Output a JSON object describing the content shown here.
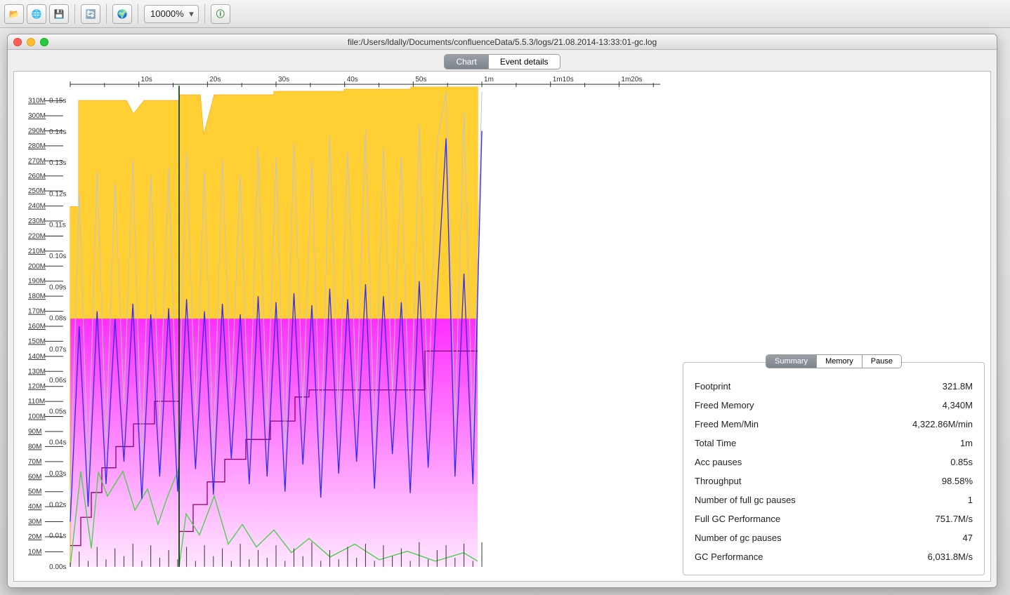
{
  "toolbar": {
    "zoom_value": "10000%",
    "icons": [
      "folder",
      "globe",
      "save",
      "refresh",
      "world",
      "info"
    ]
  },
  "window": {
    "title": "file:/Users/ldally/Documents/confluenceData/5.5.3/logs/21.08.2014-13:33:01-gc.log",
    "tabs": {
      "chart": "Chart",
      "details": "Event details"
    }
  },
  "summary": {
    "tabs": {
      "summary": "Summary",
      "memory": "Memory",
      "pause": "Pause"
    },
    "rows": [
      {
        "label": "Footprint",
        "value": "321.8M"
      },
      {
        "label": "Freed Memory",
        "value": "4,340M"
      },
      {
        "label": "Freed Mem/Min",
        "value": "4,322.86M/min"
      },
      {
        "label": "Total Time",
        "value": "1m"
      },
      {
        "label": "Acc pauses",
        "value": "0.85s"
      },
      {
        "label": "Throughput",
        "value": "98.58%"
      },
      {
        "label": "Number of full gc pauses",
        "value": "1"
      },
      {
        "label": "Full GC Performance",
        "value": "751.7M/s"
      },
      {
        "label": "Number of gc pauses",
        "value": "47"
      },
      {
        "label": "GC Performance",
        "value": "6,031.8M/s"
      }
    ]
  },
  "chart_data": {
    "type": "area",
    "xlabel": "time",
    "x_ticks": [
      "",
      "10s",
      "20s",
      "30s",
      "40s",
      "50s",
      "1m",
      "1m10s",
      "1m20s"
    ],
    "y_left_memory_ticks_M": [
      10,
      20,
      30,
      40,
      50,
      60,
      70,
      80,
      90,
      100,
      110,
      120,
      130,
      140,
      150,
      160,
      170,
      180,
      190,
      200,
      210,
      220,
      230,
      240,
      250,
      260,
      270,
      280,
      290,
      300,
      310
    ],
    "y_right_pause_ticks_s": [
      0.0,
      0.01,
      0.02,
      0.03,
      0.04,
      0.05,
      0.06,
      0.07,
      0.08,
      0.09,
      0.1,
      0.11,
      0.12,
      0.13,
      0.14,
      0.15
    ],
    "heap_total_M_at_ticks": [
      240,
      310,
      295,
      310,
      312,
      314,
      316,
      316,
      316
    ],
    "young_region_top_M": 165,
    "tenured_used_M_steps": [
      20,
      60,
      80,
      100,
      115,
      125,
      130,
      133,
      135,
      138,
      140,
      140,
      140,
      145,
      150
    ],
    "gc_pause_series_s": [
      0.01,
      0.08,
      0.02,
      0.11,
      0.03,
      0.1,
      0.05,
      0.13,
      0.02,
      0.12,
      0.04,
      0.09,
      0.03,
      0.11,
      0.02,
      0.12,
      0.05,
      0.1,
      0.02,
      0.13,
      0.03,
      0.09,
      0.04,
      0.12,
      0.02,
      0.1,
      0.05,
      0.14,
      0.02,
      0.09,
      0.03,
      0.11,
      0.04,
      0.13,
      0.02,
      0.12,
      0.05,
      0.1,
      0.02,
      0.14,
      0.03,
      0.09,
      0.12,
      0.04,
      0.13,
      0.02,
      0.14
    ],
    "heap_used_before_gc_M": [
      30,
      160,
      40,
      170,
      55,
      165,
      70,
      175,
      45,
      168,
      60,
      172,
      50,
      178,
      65,
      170,
      48,
      175,
      72,
      168,
      55,
      180,
      60,
      176,
      50,
      182,
      68,
      174,
      46,
      185,
      62,
      178,
      70,
      188,
      52,
      180,
      75,
      176,
      49,
      190,
      66,
      182,
      285,
      60,
      195,
      55,
      290
    ],
    "young_gc_duration_green_s": [
      0.03,
      0.028,
      0.022,
      0.025,
      0.02,
      0.03,
      0.018,
      0.022,
      0.016,
      0.025,
      0.02,
      0.018,
      0.022,
      0.016,
      0.02,
      0.018,
      0.015,
      0.014,
      0.016,
      0.013,
      0.018,
      0.012,
      0.015,
      0.01,
      0.012
    ]
  }
}
